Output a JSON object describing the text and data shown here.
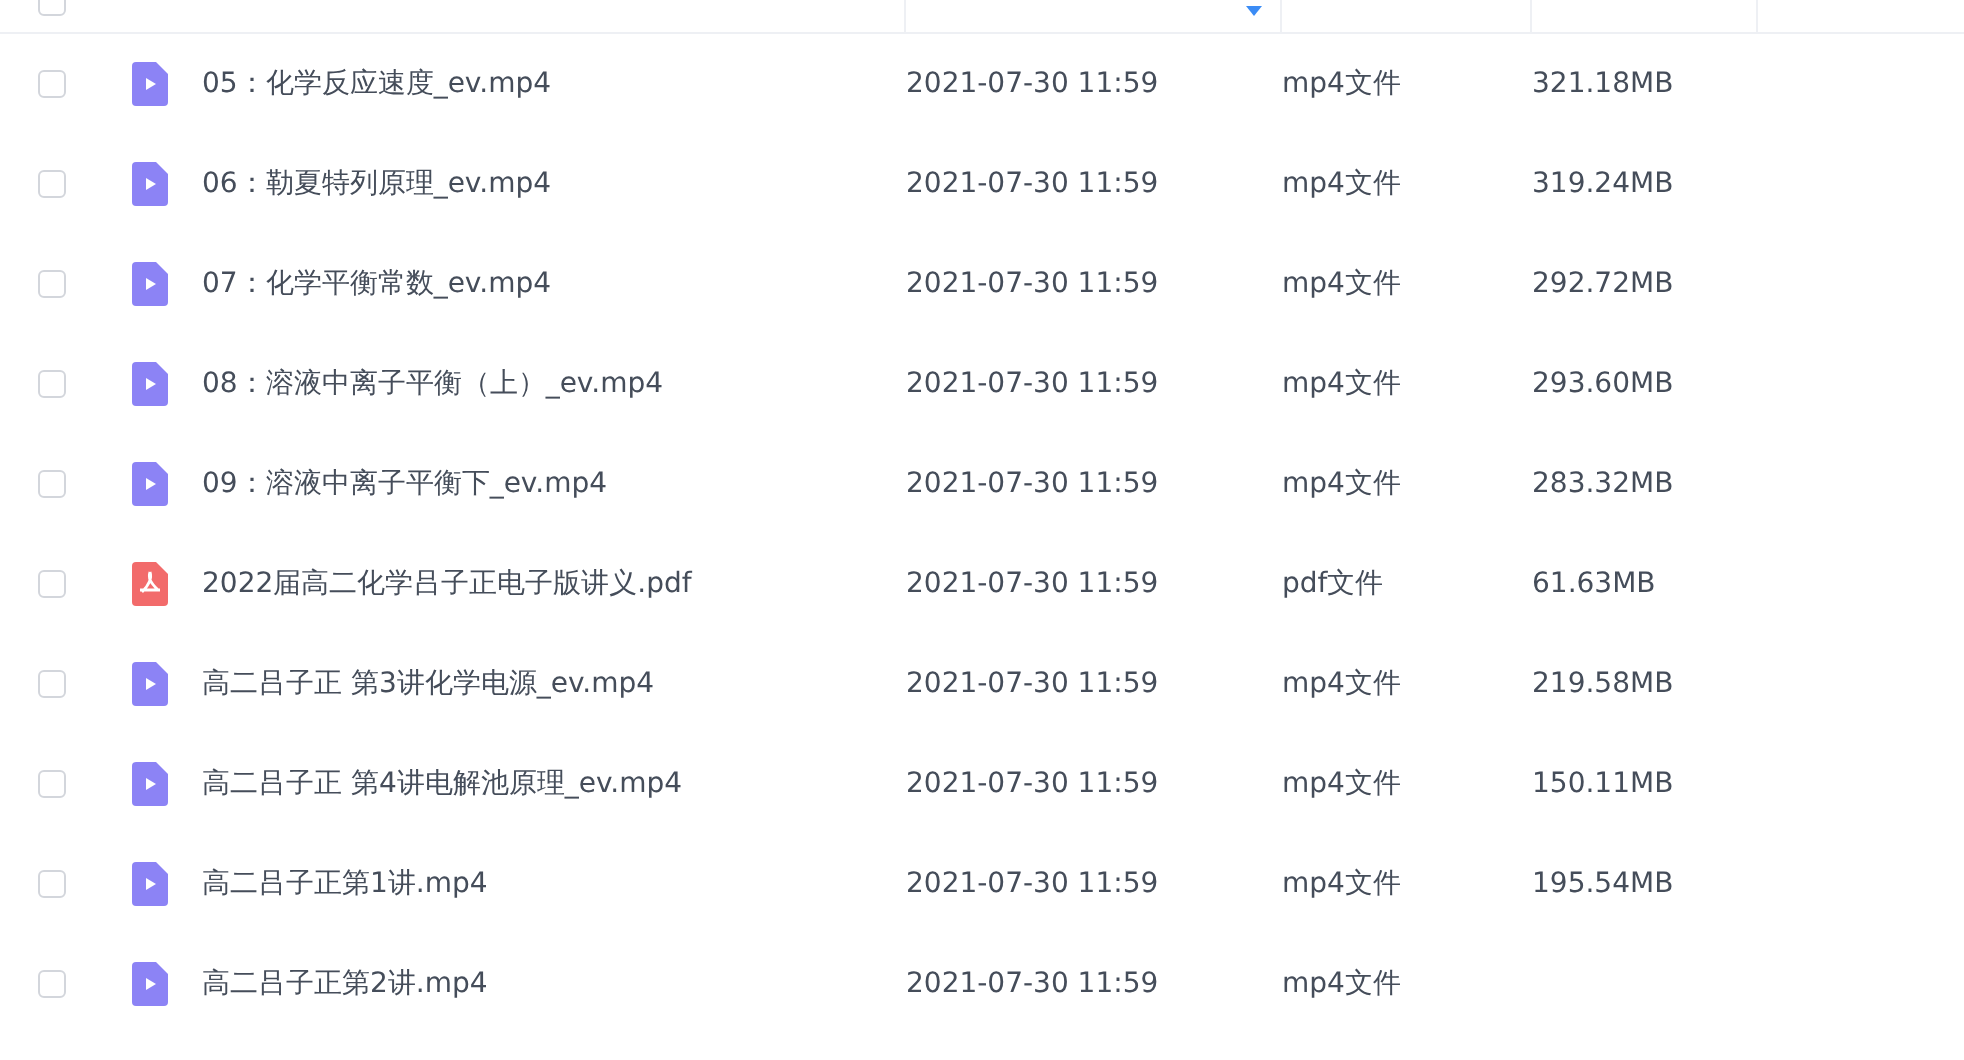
{
  "header": {
    "select_all": {
      "checked": false
    },
    "sort": {
      "descending": true
    }
  },
  "files": [
    {
      "kind": "video",
      "checked": false,
      "name": "05：化学反应速度_ev.mp4",
      "modified": "2021-07-30 11:59",
      "type": "mp4文件",
      "size": "321.18MB"
    },
    {
      "kind": "video",
      "checked": false,
      "name": "06：勒夏特列原理_ev.mp4",
      "modified": "2021-07-30 11:59",
      "type": "mp4文件",
      "size": "319.24MB"
    },
    {
      "kind": "video",
      "checked": false,
      "name": "07：化学平衡常数_ev.mp4",
      "modified": "2021-07-30 11:59",
      "type": "mp4文件",
      "size": "292.72MB"
    },
    {
      "kind": "video",
      "checked": false,
      "name": "08：溶液中离子平衡（上）_ev.mp4",
      "modified": "2021-07-30 11:59",
      "type": "mp4文件",
      "size": "293.60MB"
    },
    {
      "kind": "video",
      "checked": false,
      "name": "09：溶液中离子平衡下_ev.mp4",
      "modified": "2021-07-30 11:59",
      "type": "mp4文件",
      "size": "283.32MB"
    },
    {
      "kind": "pdf",
      "checked": false,
      "name": "2022届高二化学吕子正电子版讲义.pdf",
      "modified": "2021-07-30 11:59",
      "type": "pdf文件",
      "size": "61.63MB"
    },
    {
      "kind": "video",
      "checked": false,
      "name": "高二吕子正 第3讲化学电源_ev.mp4",
      "modified": "2021-07-30 11:59",
      "type": "mp4文件",
      "size": "219.58MB"
    },
    {
      "kind": "video",
      "checked": false,
      "name": "高二吕子正 第4讲电解池原理_ev.mp4",
      "modified": "2021-07-30 11:59",
      "type": "mp4文件",
      "size": "150.11MB"
    },
    {
      "kind": "video",
      "checked": false,
      "name": "高二吕子正第1讲.mp4",
      "modified": "2021-07-30 11:59",
      "type": "mp4文件",
      "size": "195.54MB"
    },
    {
      "kind": "video",
      "checked": false,
      "name": "高二吕子正第2讲.mp4",
      "modified": "2021-07-30 11:59",
      "type": "mp4文件"
    }
  ]
}
